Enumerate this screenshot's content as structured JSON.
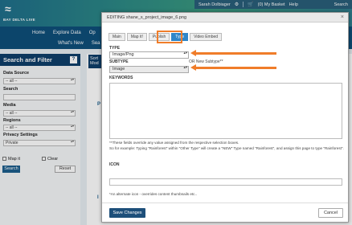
{
  "site": {
    "logo_text": "BAY DELTA LIVE",
    "user_name": "Sarah Dolbiager",
    "basket": "(0) My Basket",
    "help": "Help",
    "search": "Search"
  },
  "nav": {
    "row1": [
      "Home",
      "Explore Data",
      "Op"
    ],
    "row2": [
      "What's New",
      "Sea"
    ]
  },
  "sidebar": {
    "title": "Search and Filter",
    "help": "?",
    "data_source_label": "Data Source",
    "data_source_value": "-- all --",
    "search_label": "Search",
    "media_label": "Media",
    "media_value": "-- all --",
    "regions_label": "Regions",
    "regions_value": "-- all --",
    "privacy_label": "Privacy Settings",
    "privacy_value": "Private",
    "map_it": "Map it",
    "clear": "Clear",
    "search_button": "Search",
    "reset_button": "Reset"
  },
  "main": {
    "sort_tab": "Sort Mod",
    "p_fragment": "P",
    "l_fragment": "I"
  },
  "modal": {
    "title": "EDITING shane_s_project_image_6.png",
    "close": "×",
    "tabs": [
      "Main",
      "Map it!",
      "Publish",
      "Type",
      "Video Embed"
    ],
    "active_tab": 3,
    "type_label": "TYPE",
    "type_value": "Image/Png",
    "subtype_label": "SUBTYPE",
    "or_new_subtype": "OR New Subtype**",
    "subtype_value": "Image",
    "keywords_label": "KEYWORDS",
    "note1": "**These fields override any value assigned from the respective selection boxes.",
    "note2": "So for example: Typing \"Rainforest\" within \"Other Type\" will create a \"NEW\" Type named \"Rainforest\", and assign this page to type \"Rainforest\".",
    "icon_label": "ICON",
    "icon_note": "*An alternate icon - overrides content thumbnails etc..",
    "save_button": "Save Changes",
    "cancel_button": "Cancel"
  },
  "colors": {
    "annotation": "#f07d2a",
    "nav": "#0e4f7a",
    "active_tab": "#2f86c8"
  }
}
